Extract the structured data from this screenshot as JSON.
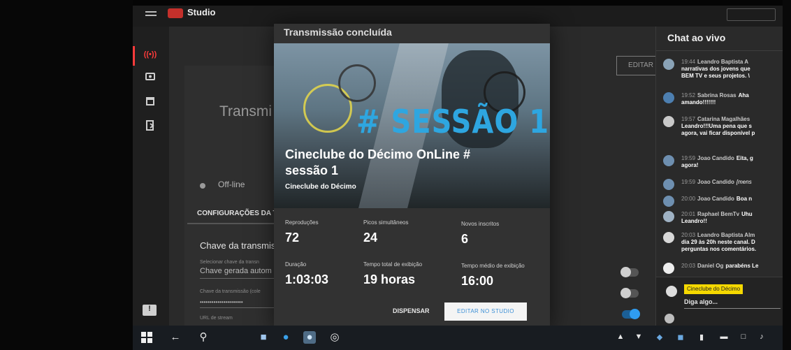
{
  "app": {
    "logo_text": "Studio"
  },
  "background_page": {
    "title": "Transmi",
    "status": "Off-line",
    "settings_tab": "CONFIGURAÇÕES DA T",
    "stream_key_title": "Chave da transmissã",
    "select_key_label": "Selecionar chave da transn",
    "select_key_value": "Chave gerada autom",
    "key_label": "Chave da transmissão (cole",
    "key_value": "••••••••••••••••••••••",
    "url_label": "URL de stream",
    "edit_button": "EDITAR"
  },
  "modal": {
    "title": "Transmissão concluída",
    "hero_hashtag": "# SESSÃO 1",
    "video_title_line1": "Cineclube do Décimo OnLine #",
    "video_title_line2": "sessão 1",
    "channel": "Cineclube do Décimo",
    "stats": [
      {
        "label": "Reproduções",
        "value": "72"
      },
      {
        "label": "Picos simultâneos",
        "value": "24"
      },
      {
        "label": "Novos inscritos",
        "value": "6"
      },
      {
        "label": "Duração",
        "value": "1:03:03"
      },
      {
        "label": "Tempo total de exibição",
        "value": "19 horas"
      },
      {
        "label": "Tempo médio de exibição",
        "value": "16:00"
      }
    ],
    "dismiss_button": "DISPENSAR",
    "edit_studio_button": "EDITAR NO STUDIO"
  },
  "chat": {
    "title": "Chat ao vivo",
    "messages": [
      {
        "time": "19:44",
        "author": "Leandro Baptista A",
        "line1": "narrativas dos jovens que",
        "line2": "BEM TV e seus projetos. \\"
      },
      {
        "time": "19:52",
        "author": "Sabrina Rosas",
        "line1": "Aha",
        "line2": "amando!!!!!!!"
      },
      {
        "time": "19:57",
        "author": "Catarina Magalhães",
        "line1": "Leandro!!!Uma pena que s",
        "line2": "agora, vai ficar disponível p"
      },
      {
        "time": "19:59",
        "author": "Joao Candido",
        "line1": "Eita, g",
        "line2": "agora!"
      },
      {
        "time": "19:59",
        "author": "Joao Candido",
        "line1": "[mens",
        "line2": ""
      },
      {
        "time": "20:00",
        "author": "Joao Candido",
        "line1": "Boa n",
        "line2": ""
      },
      {
        "time": "20:01",
        "author": "Raphael BemTv",
        "line1": "Uhu",
        "line2": "Leandro!!"
      },
      {
        "time": "20:03",
        "author": "Leandro Baptista Alm",
        "line1": "dia 29 às 20h neste canal. D",
        "line2": "perguntas nos comentários."
      },
      {
        "time": "20:03",
        "author": "Daniel Og",
        "line1": "parabéns Le",
        "line2": ""
      }
    ],
    "user_name": "Cineclube do Décimo",
    "input_placeholder": "Diga algo..."
  },
  "colors": {
    "accent_blue": "#2ea6e0",
    "live_red": "#ff3b3b",
    "chat_user_highlight": "#f5d800"
  },
  "icons": {
    "nav": [
      "live-icon",
      "camera-icon",
      "calendar-icon",
      "exit-icon",
      "feedback-icon"
    ],
    "taskbar": [
      "windows-start-icon",
      "back-arrow-icon",
      "search-icon",
      "task-view-icon",
      "edge-icon",
      "chrome-icon",
      "obs-icon"
    ]
  }
}
